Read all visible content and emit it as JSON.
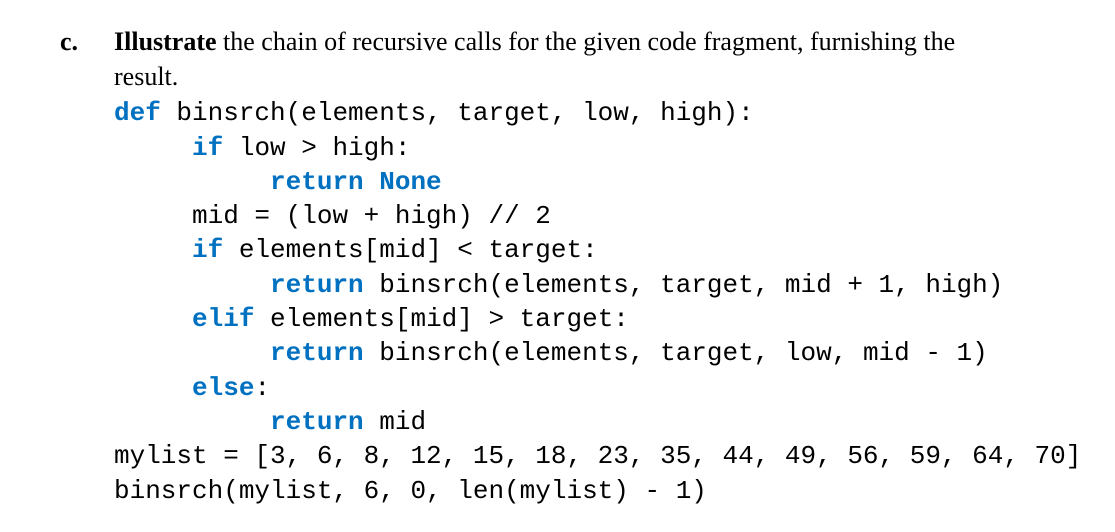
{
  "marker": "c.",
  "prompt": {
    "bold": "Illustrate",
    "rest1": " the chain of recursive calls for the given code fragment, furnishing the",
    "rest2": "result."
  },
  "code": {
    "l1_def": "def",
    "l1_rest": " binsrch(elements, target, low, high):",
    "l2_if": "if",
    "l2_rest": " low > high:",
    "l3_ret": "return None",
    "l4": "mid = (low + high) // 2",
    "l5_if": "if",
    "l5_rest": " elements[mid] < target:",
    "l6_ret": "return",
    "l6_rest": " binsrch(elements, target, mid + 1, high)",
    "l7_elif": "elif",
    "l7_rest": " elements[mid] > target:",
    "l8_ret": "return",
    "l8_rest": " binsrch(elements, target, low, mid - 1)",
    "l9_else": "else",
    "l9_rest": ":",
    "l10_ret": "return",
    "l10_rest": " mid",
    "l11": "mylist = [3, 6, 8, 12, 15, 18, 23, 35, 44, 49, 56, 59, 64, 70]",
    "l12": "binsrch(mylist, 6, 0, len(mylist) - 1)"
  }
}
